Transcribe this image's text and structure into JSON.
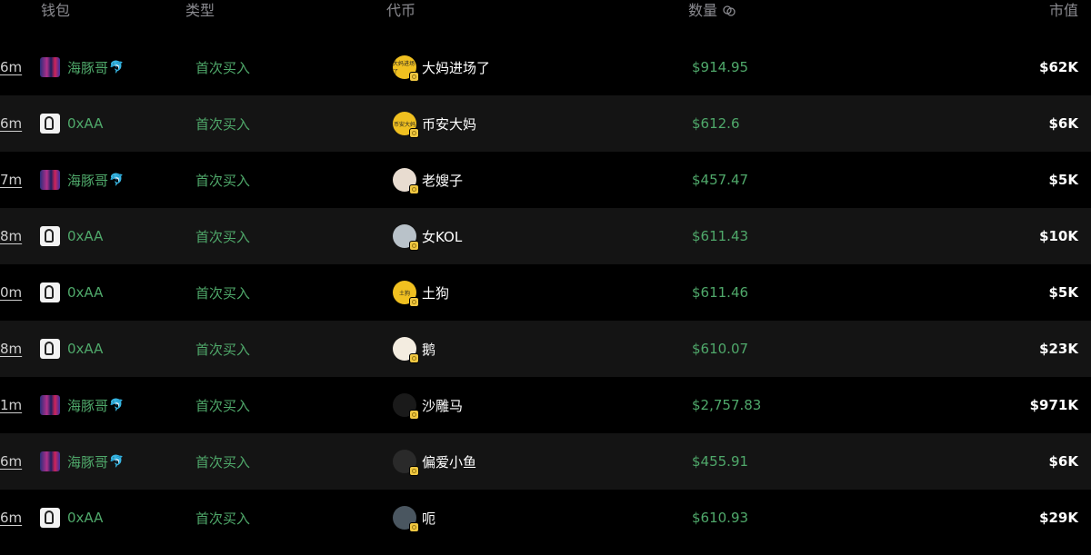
{
  "header": {
    "wallet": "钱包",
    "type": "类型",
    "token": "代币",
    "amount": "数量",
    "market_cap": "市值"
  },
  "colors": {
    "green": "#4fa86a",
    "row_alt": "#141414",
    "badge": "#f0c742"
  },
  "rows": [
    {
      "time": "6m",
      "wallet": "海豚哥",
      "wallet_avatar": "dolphin",
      "wallet_emoji": "🐬",
      "type": "首次买入",
      "token": "大妈进场了",
      "token_avatar": {
        "bg": "#f0c020",
        "text": "大妈进场了"
      },
      "amount": "$914.95",
      "market_cap": "$62K"
    },
    {
      "time": "6m",
      "wallet": "0xAA",
      "wallet_avatar": "aa",
      "wallet_emoji": "",
      "type": "首次买入",
      "token": "币安大妈",
      "token_avatar": {
        "bg": "#f0c020",
        "text": "币安大妈"
      },
      "amount": "$612.6",
      "market_cap": "$6K"
    },
    {
      "time": "7m",
      "wallet": "海豚哥",
      "wallet_avatar": "dolphin",
      "wallet_emoji": "🐬",
      "type": "首次买入",
      "token": "老嫂子",
      "token_avatar": {
        "bg": "#e8dcd0",
        "text": ""
      },
      "amount": "$457.47",
      "market_cap": "$5K"
    },
    {
      "time": "8m",
      "wallet": "0xAA",
      "wallet_avatar": "aa",
      "wallet_emoji": "",
      "type": "首次买入",
      "token": "女KOL",
      "token_avatar": {
        "bg": "#b9c2c9",
        "text": ""
      },
      "amount": "$611.43",
      "market_cap": "$10K"
    },
    {
      "time": "0m",
      "wallet": "0xAA",
      "wallet_avatar": "aa",
      "wallet_emoji": "",
      "type": "首次买入",
      "token": "土狗",
      "token_avatar": {
        "bg": "#f0c020",
        "text": "土狗"
      },
      "amount": "$611.46",
      "market_cap": "$5K"
    },
    {
      "time": "8m",
      "wallet": "0xAA",
      "wallet_avatar": "aa",
      "wallet_emoji": "",
      "type": "首次买入",
      "token": "鹅",
      "token_avatar": {
        "bg": "#f3ece0",
        "text": ""
      },
      "amount": "$610.07",
      "market_cap": "$23K"
    },
    {
      "time": "1m",
      "wallet": "海豚哥",
      "wallet_avatar": "dolphin",
      "wallet_emoji": "🐬",
      "type": "首次买入",
      "token": "沙雕马",
      "token_avatar": {
        "bg": "#1a1a1a",
        "text": ""
      },
      "amount": "$2,757.83",
      "market_cap": "$971K"
    },
    {
      "time": "6m",
      "wallet": "海豚哥",
      "wallet_avatar": "dolphin",
      "wallet_emoji": "🐬",
      "type": "首次买入",
      "token": "偏爱小鱼",
      "token_avatar": {
        "bg": "#2a2a2a",
        "text": ""
      },
      "amount": "$455.91",
      "market_cap": "$6K"
    },
    {
      "time": "6m",
      "wallet": "0xAA",
      "wallet_avatar": "aa",
      "wallet_emoji": "",
      "type": "首次买入",
      "token": "呃",
      "token_avatar": {
        "bg": "#4a5660",
        "text": ""
      },
      "amount": "$610.93",
      "market_cap": "$29K"
    }
  ]
}
